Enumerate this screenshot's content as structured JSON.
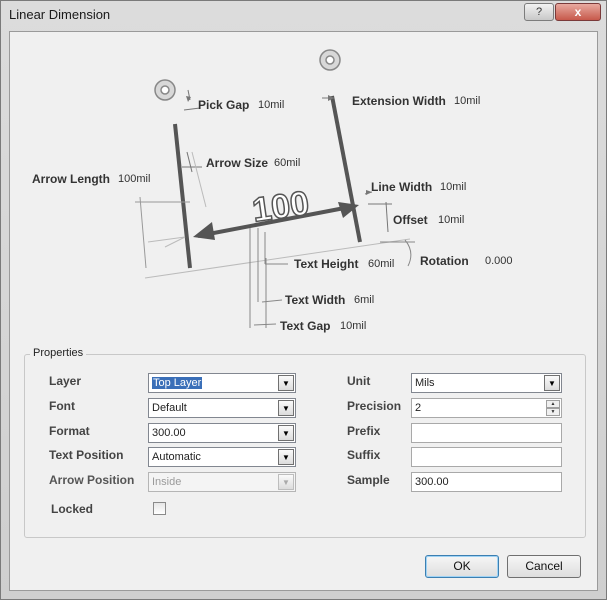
{
  "window": {
    "title": "Linear Dimension",
    "help_label": "?",
    "close_label": "x"
  },
  "diagram": {
    "pick_gap": {
      "label": "Pick Gap",
      "value": "10mil"
    },
    "extension_width": {
      "label": "Extension Width",
      "value": "10mil"
    },
    "arrow_size": {
      "label": "Arrow Size",
      "value": "60mil"
    },
    "arrow_length": {
      "label": "Arrow Length",
      "value": "100mil"
    },
    "line_width": {
      "label": "Line Width",
      "value": "10mil"
    },
    "offset": {
      "label": "Offset",
      "value": "10mil"
    },
    "text_height": {
      "label": "Text Height",
      "value": "60mil"
    },
    "rotation": {
      "label": "Rotation",
      "value": "0.000"
    },
    "text_width": {
      "label": "Text Width",
      "value": "6mil"
    },
    "text_gap": {
      "label": "Text Gap",
      "value": "10mil"
    },
    "sample_text": "100"
  },
  "properties": {
    "title": "Properties",
    "layer": {
      "label": "Layer",
      "value": "Top Layer"
    },
    "font": {
      "label": "Font",
      "value": "Default"
    },
    "format": {
      "label": "Format",
      "value": "300.00"
    },
    "text_position": {
      "label": "Text Position",
      "value": "Automatic"
    },
    "arrow_position": {
      "label": "Arrow Position",
      "value": "Inside"
    },
    "locked": {
      "label": "Locked",
      "checked": false
    },
    "unit": {
      "label": "Unit",
      "value": "Mils"
    },
    "precision": {
      "label": "Precision",
      "value": "2"
    },
    "prefix": {
      "label": "Prefix",
      "value": ""
    },
    "suffix": {
      "label": "Suffix",
      "value": ""
    },
    "sample": {
      "label": "Sample",
      "value": "300.00"
    }
  },
  "buttons": {
    "ok": "OK",
    "cancel": "Cancel"
  },
  "icons": {
    "dropdown": "chevron-down-icon",
    "spin_up": "spin-up-icon",
    "spin_down": "spin-down-icon",
    "pick_point": "target-circle-icon"
  }
}
